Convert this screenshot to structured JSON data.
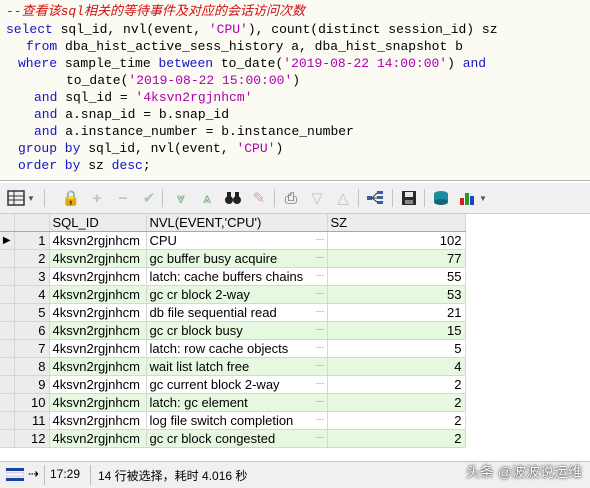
{
  "editor": {
    "comment": "--查看该sql相关的等待事件及对应的会话访问次数",
    "lines": [
      {
        "kw1": "select",
        "rest": " sql_id, nvl(event, ",
        "s1": "'CPU'",
        "rest2": "), count(distinct session_id) sz"
      },
      {
        "kw1": "from",
        "rest": " dba_hist_active_sess_history a, dba_hist_snapshot b"
      },
      {
        "kw1": "where",
        "rest": " sample_time ",
        "kw2": "between",
        "rest2": " to_date(",
        "s1": "'2019-08-22 14:00:00'",
        "rest3": ") ",
        "kw3": "and"
      },
      {
        "rest": "to_date(",
        "s1": "'2019-08-22 15:00:00'",
        "rest2": ")"
      },
      {
        "kw1": "and",
        "rest": " sql_id = ",
        "s1": "'4ksvn2rgjnhcm'"
      },
      {
        "kw1": "and",
        "rest": " a.snap_id = b.snap_id"
      },
      {
        "kw1": "and",
        "rest": " a.instance_number = b.instance_number"
      },
      {
        "kw1": "group by",
        "rest": " sql_id, nvl(event, ",
        "s1": "'CPU'",
        "rest2": ")"
      },
      {
        "kw1": "order by",
        "rest": " sz ",
        "kw2": "desc",
        "rest2": ";"
      }
    ]
  },
  "grid": {
    "columns": [
      "SQL_ID",
      "NVL(EVENT,'CPU')",
      "SZ"
    ],
    "rows": [
      {
        "n": "1",
        "sql_id": "4ksvn2rgjnhcm",
        "event": "CPU",
        "sz": "102"
      },
      {
        "n": "2",
        "sql_id": "4ksvn2rgjnhcm",
        "event": "gc buffer busy acquire",
        "sz": "77"
      },
      {
        "n": "3",
        "sql_id": "4ksvn2rgjnhcm",
        "event": "latch: cache buffers chains",
        "sz": "55"
      },
      {
        "n": "4",
        "sql_id": "4ksvn2rgjnhcm",
        "event": "gc cr block 2-way",
        "sz": "53"
      },
      {
        "n": "5",
        "sql_id": "4ksvn2rgjnhcm",
        "event": "db file sequential read",
        "sz": "21"
      },
      {
        "n": "6",
        "sql_id": "4ksvn2rgjnhcm",
        "event": "gc cr block busy",
        "sz": "15"
      },
      {
        "n": "7",
        "sql_id": "4ksvn2rgjnhcm",
        "event": "latch: row cache objects",
        "sz": "5"
      },
      {
        "n": "8",
        "sql_id": "4ksvn2rgjnhcm",
        "event": "wait list latch free",
        "sz": "4"
      },
      {
        "n": "9",
        "sql_id": "4ksvn2rgjnhcm",
        "event": "gc current block 2-way",
        "sz": "2"
      },
      {
        "n": "10",
        "sql_id": "4ksvn2rgjnhcm",
        "event": "latch: gc element",
        "sz": "2"
      },
      {
        "n": "11",
        "sql_id": "4ksvn2rgjnhcm",
        "event": "log file switch completion",
        "sz": "2"
      },
      {
        "n": "12",
        "sql_id": "4ksvn2rgjnhcm",
        "event": "gc cr block congested",
        "sz": "2"
      }
    ]
  },
  "status": {
    "time": "17:29",
    "message": "14 行被选择，耗时 4.016 秒"
  },
  "watermark": "头条 @波波说运维",
  "colors": {
    "keyword": "#1414c8",
    "string": "#b000b0",
    "comment": "#d01010",
    "row_alt": "#e6f8e0"
  }
}
